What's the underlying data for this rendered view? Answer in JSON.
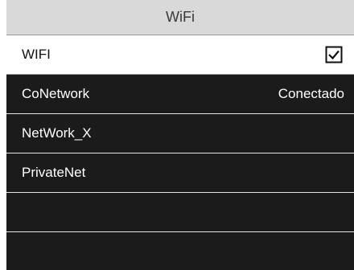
{
  "header": {
    "title": "WiFi"
  },
  "wifi_toggle": {
    "label": "WIFI",
    "checked": true
  },
  "networks": [
    {
      "name": "CoNetwork",
      "status": "Conectado"
    },
    {
      "name": "NetWork_X",
      "status": ""
    },
    {
      "name": "PrivateNet",
      "status": ""
    }
  ],
  "colors": {
    "background": "#1b1b1b",
    "title_bar": "#d9d9d9",
    "selected_row": "#ffffff",
    "text_light": "#ffffff",
    "text_dark": "#111111"
  }
}
